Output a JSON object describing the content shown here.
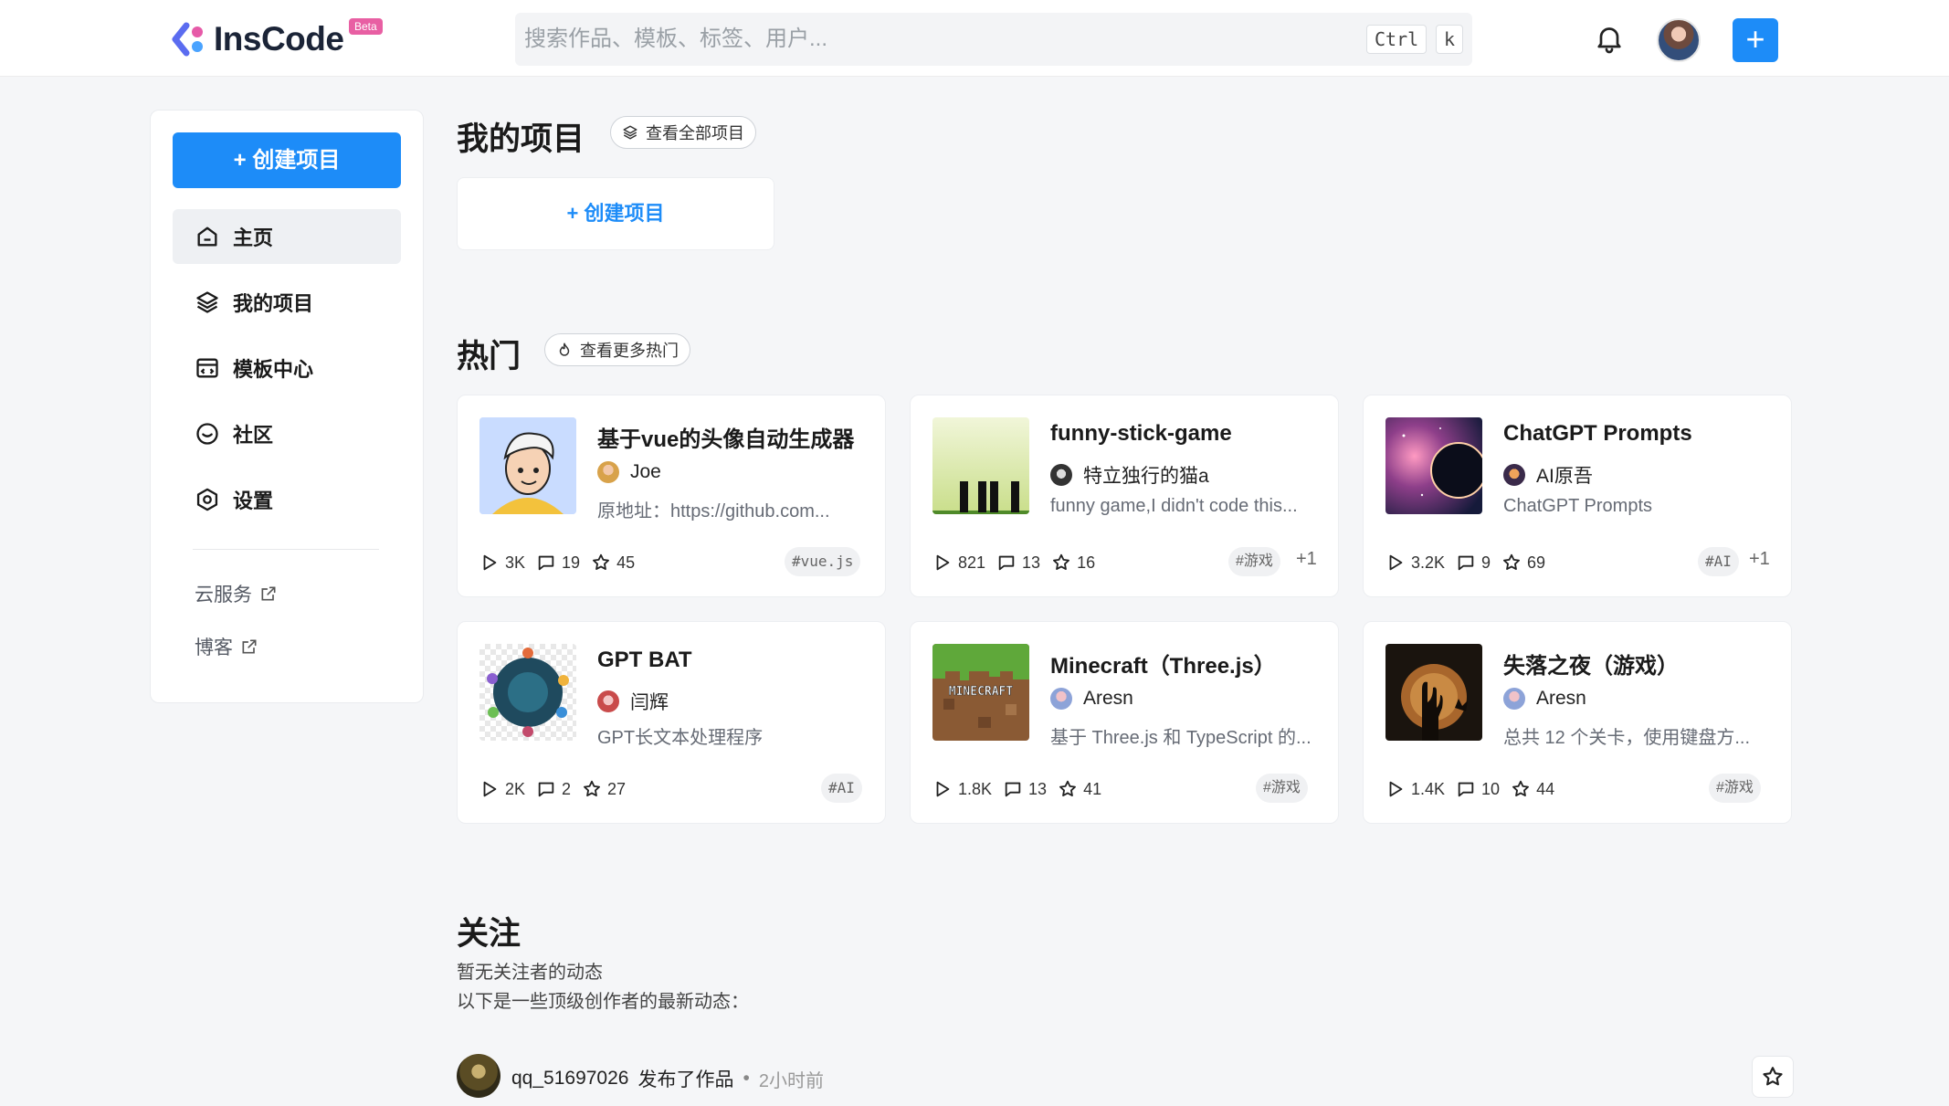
{
  "header": {
    "logo_text": "InsCode",
    "beta_label": "Beta",
    "search_placeholder": "搜索作品、模板、标签、用户...",
    "shortcut_ctrl": "Ctrl",
    "shortcut_key": "k",
    "plus_label": "+"
  },
  "sidebar": {
    "create_label": "+ 创建项目",
    "items": [
      {
        "label": "主页",
        "icon": "home-icon",
        "active": true
      },
      {
        "label": "我的项目",
        "icon": "layers-icon",
        "active": false
      },
      {
        "label": "模板中心",
        "icon": "template-icon",
        "active": false
      },
      {
        "label": "社区",
        "icon": "community-icon",
        "active": false
      },
      {
        "label": "设置",
        "icon": "settings-icon",
        "active": false
      }
    ],
    "links": [
      {
        "label": "云服务",
        "icon": "external-link-icon"
      },
      {
        "label": "博客",
        "icon": "external-link-icon"
      }
    ]
  },
  "my_projects": {
    "title": "我的项目",
    "view_all": "查看全部项目",
    "create_label": "+ 创建项目"
  },
  "hot": {
    "title": "热门",
    "view_more": "查看更多热门",
    "cards": [
      {
        "title": "基于vue的头像自动生成器",
        "author": "Joe",
        "desc": "原地址：https://github.com...",
        "runs": "3K",
        "comments": "19",
        "stars": "45",
        "tag": "#vue.js",
        "extra": ""
      },
      {
        "title": "funny-stick-game",
        "author": "特立独行的猫a",
        "desc": "funny game,I didn't code this...",
        "runs": "821",
        "comments": "13",
        "stars": "16",
        "tag": "#游戏",
        "extra": "+1"
      },
      {
        "title": "ChatGPT Prompts",
        "author": "AI原吾",
        "desc": "ChatGPT Prompts",
        "runs": "3.2K",
        "comments": "9",
        "stars": "69",
        "tag": "#AI",
        "extra": "+1"
      },
      {
        "title": "GPT BAT",
        "author": "闫辉",
        "desc": "GPT长文本处理程序",
        "runs": "2K",
        "comments": "2",
        "stars": "27",
        "tag": "#AI",
        "extra": ""
      },
      {
        "title": "Minecraft（Three.js）",
        "author": "Aresn",
        "desc": "基于 Three.js 和 TypeScript 的...",
        "runs": "1.8K",
        "comments": "13",
        "stars": "41",
        "tag": "#游戏",
        "extra": ""
      },
      {
        "title": "失落之夜（游戏）",
        "author": "Aresn",
        "desc": "总共 12 个关卡，使用键盘方...",
        "runs": "1.4K",
        "comments": "10",
        "stars": "44",
        "tag": "#游戏",
        "extra": ""
      }
    ]
  },
  "follow": {
    "title": "关注",
    "empty_text": "暂无关注者的动态",
    "sub_text": "以下是一些顶级创作者的最新动态：",
    "feed": [
      {
        "user": "qq_51697026",
        "action": "发布了作品",
        "time": "2小时前"
      }
    ]
  },
  "colors": {
    "accent": "#1d8cf8",
    "background": "#f5f6f8"
  }
}
